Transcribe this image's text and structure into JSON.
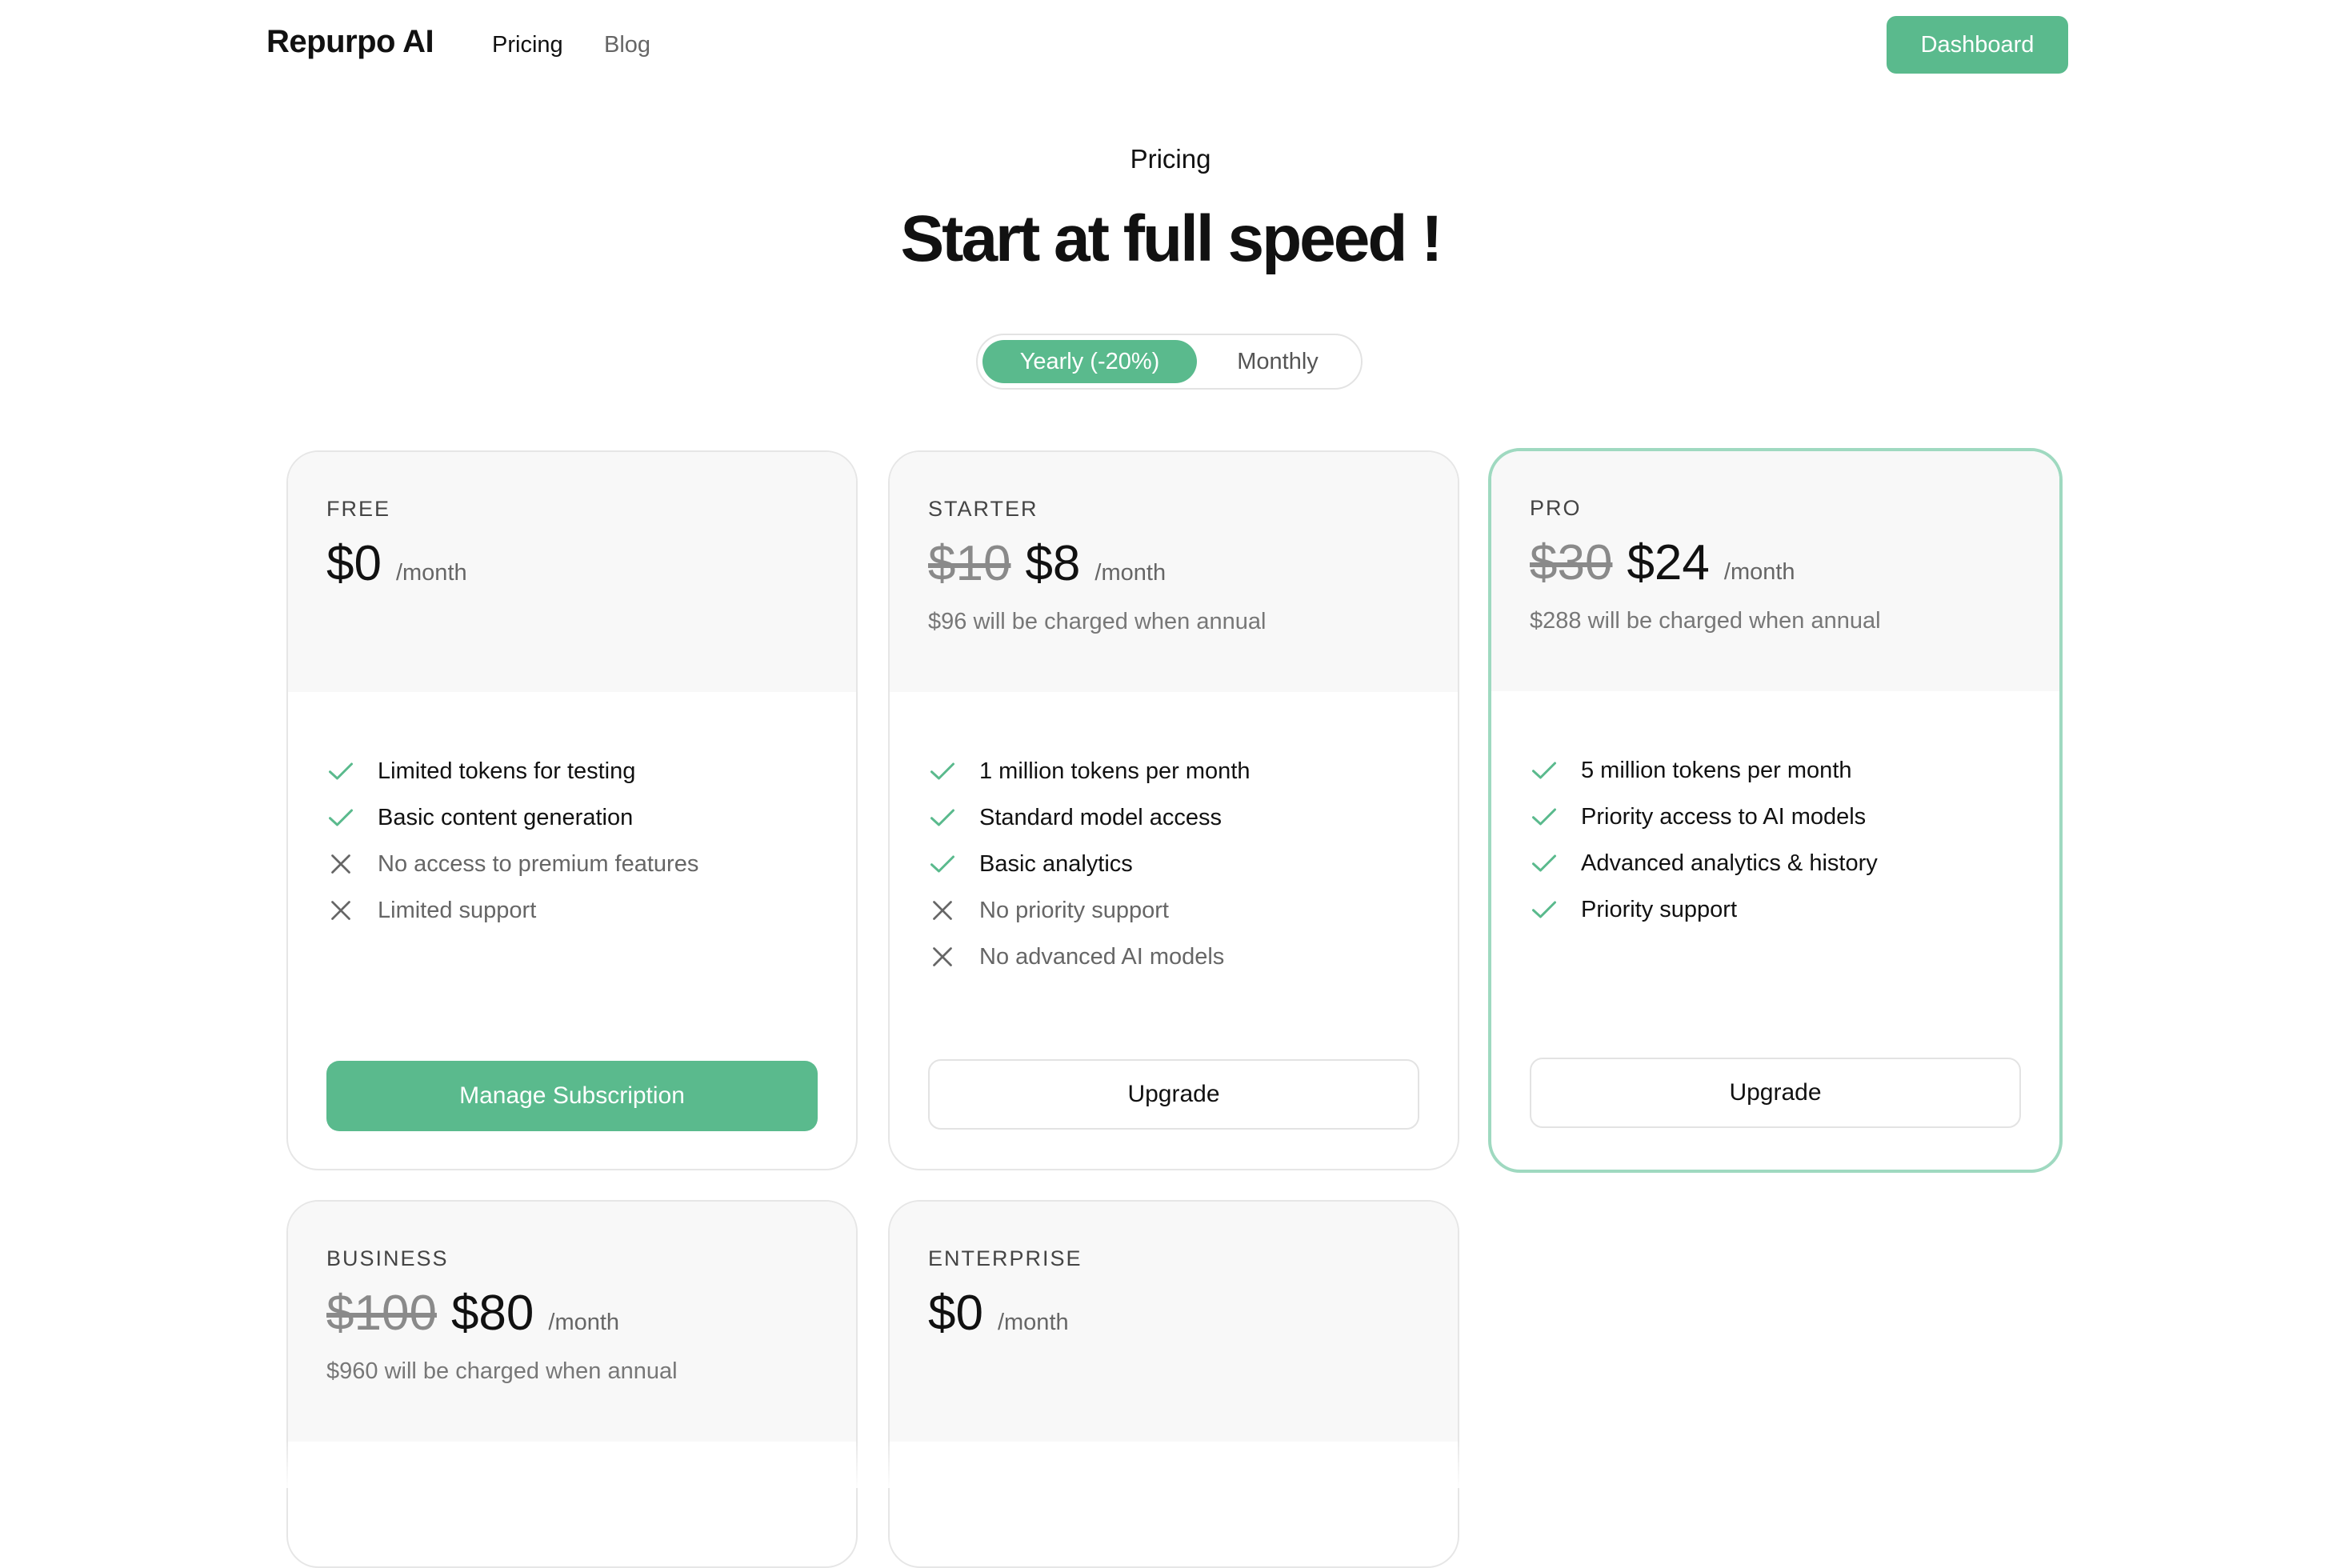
{
  "nav": {
    "brand": "Repurpo AI",
    "links": [
      "Pricing",
      "Blog"
    ],
    "dashboard": "Dashboard"
  },
  "hero": {
    "eyebrow": "Pricing",
    "headline": "Start at full speed !"
  },
  "billing_toggle": {
    "options": [
      "Yearly (-20%)",
      "Monthly"
    ],
    "selected": "Yearly (-20%)"
  },
  "plans": [
    {
      "tier": "FREE",
      "old_price": "",
      "price": "$0",
      "period": "/month",
      "annual_note": "",
      "features": [
        {
          "text": "Limited tokens for testing",
          "included": true
        },
        {
          "text": "Basic content generation",
          "included": true
        },
        {
          "text": "No access to premium features",
          "included": false
        },
        {
          "text": "Limited support",
          "included": false
        }
      ],
      "button": "Manage Subscription"
    },
    {
      "tier": "STARTER",
      "old_price": "$10",
      "price": "$8",
      "period": "/month",
      "annual_note": "$96 will be charged when annual",
      "features": [
        {
          "text": "1 million tokens per month",
          "included": true
        },
        {
          "text": "Standard model access",
          "included": true
        },
        {
          "text": "Basic analytics",
          "included": true
        },
        {
          "text": "No priority support",
          "included": false
        },
        {
          "text": "No advanced AI models",
          "included": false
        }
      ],
      "button": "Upgrade"
    },
    {
      "tier": "PRO",
      "old_price": "$30",
      "price": "$24",
      "period": "/month",
      "annual_note": "$288 will be charged when annual",
      "features": [
        {
          "text": "5 million tokens per month",
          "included": true
        },
        {
          "text": "Priority access to AI models",
          "included": true
        },
        {
          "text": "Advanced analytics & history",
          "included": true
        },
        {
          "text": "Priority support",
          "included": true
        }
      ],
      "button": "Upgrade"
    },
    {
      "tier": "BUSINESS",
      "old_price": "$100",
      "price": "$80",
      "period": "/month",
      "annual_note": "$960 will be charged when annual"
    },
    {
      "tier": "ENTERPRISE",
      "old_price": "",
      "price": "$0",
      "period": "/month",
      "annual_note": ""
    }
  ],
  "colors": {
    "accent": "#5aba8d",
    "highlight_border": "#9fd9c0",
    "card_header_bg": "#f8f8f8"
  }
}
